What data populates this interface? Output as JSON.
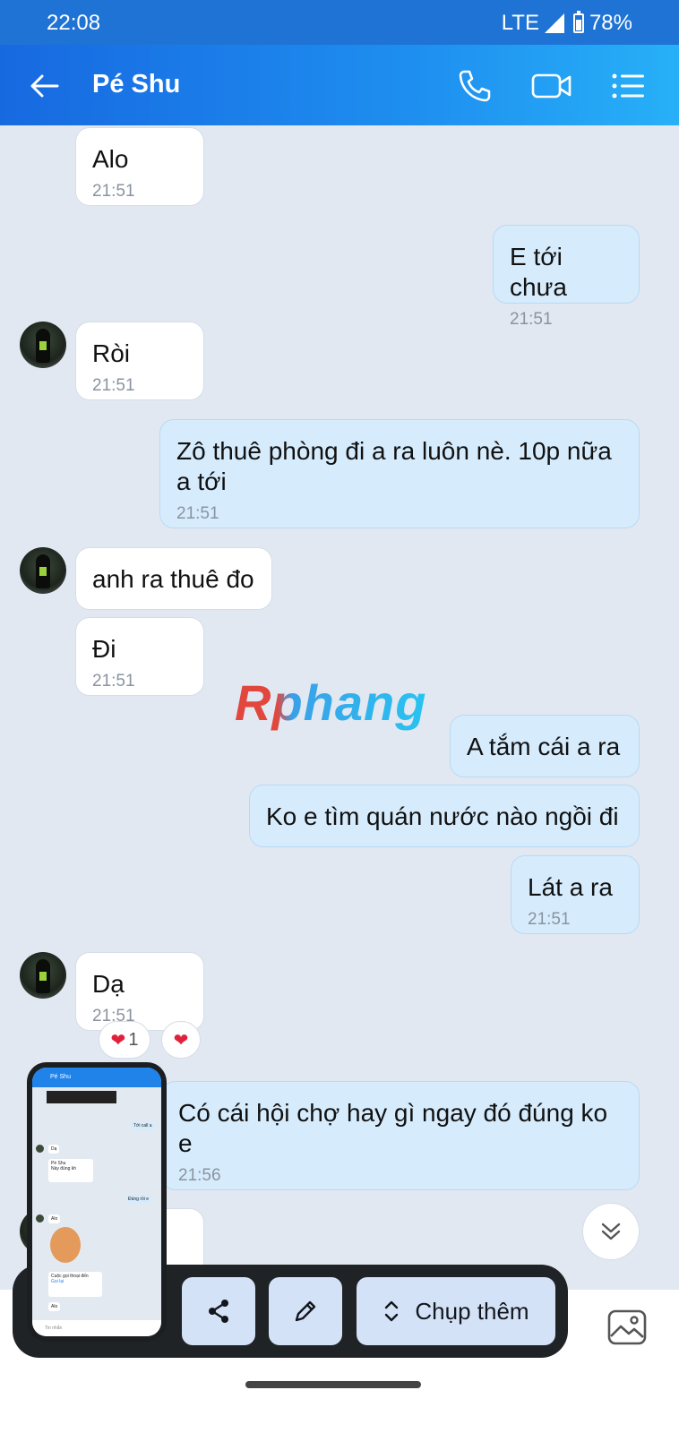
{
  "status_bar": {
    "time": "22:08",
    "network": "LTE",
    "battery": "78%",
    "battery_level": 0.78
  },
  "header": {
    "contact_name": "Pé Shu"
  },
  "messages": [
    {
      "direction": "in",
      "text": "Alo",
      "time": "21:51"
    },
    {
      "direction": "out",
      "text": "E tới chưa",
      "time": "21:51"
    },
    {
      "direction": "in",
      "text": "Ròi",
      "time": "21:51"
    },
    {
      "direction": "out",
      "text": "Zô thuê phòng đi a ra luôn nè. 10p nữa a tới",
      "time": "21:51"
    },
    {
      "direction": "in",
      "text": "anh ra thuê đo",
      "time": ""
    },
    {
      "direction": "in",
      "text": "Đi",
      "time": "21:51"
    },
    {
      "direction": "out",
      "text": "A tắm cái a ra",
      "time": ""
    },
    {
      "direction": "out",
      "text": "Ko e tìm quán nước nào ngồi đi",
      "time": ""
    },
    {
      "direction": "out",
      "text": "Lát a ra",
      "time": "21:51"
    },
    {
      "direction": "in",
      "text": "Dạ",
      "time": "21:51"
    },
    {
      "direction": "out",
      "text": "Có cái hội chợ hay  gì ngay đó đúng ko e",
      "time": "21:56"
    }
  ],
  "reactions": {
    "count": "1"
  },
  "watermark": "Rphang",
  "screenshot_toolbar": {
    "capture_more_label": "Chụp thêm"
  },
  "thumbnail": {
    "title": "Pé Shu",
    "msg1": "Tới call a",
    "msg2": "Dạ",
    "msg3": "Pé Shu",
    "msg4": "Này đúng kh",
    "msg5": "Đúng rồi e",
    "msg6": "Alo",
    "msg7": "Cuộc gọi thoại đến",
    "msg8": "Gọi lại",
    "msg9": "Alo",
    "input": "Tin nhắn"
  }
}
